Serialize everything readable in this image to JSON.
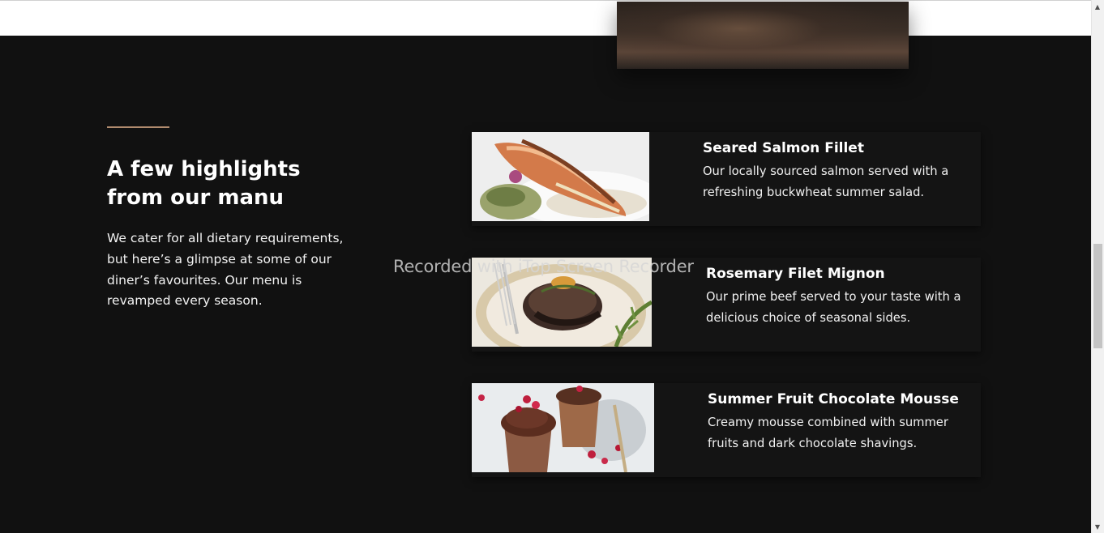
{
  "section": {
    "title": "A few highlights from our manu",
    "description": "We cater for all dietary requirements, but here’s a glimpse at some of our diner’s favourites. Our menu is revamped every season."
  },
  "menu": {
    "items": [
      {
        "title": "Seared Salmon Fillet",
        "description": "Our locally sourced salmon served with a refreshing buckwheat summer salad."
      },
      {
        "title": "Rosemary Filet Mignon",
        "description": "Our prime beef served to your taste with a delicious choice of seasonal sides."
      },
      {
        "title": "Summer Fruit Chocolate Mousse",
        "description": "Creamy mousse combined with summer fruits and dark chocolate shavings."
      }
    ]
  },
  "overlay": {
    "watermark": "Recorded with iTop Screen Recorder"
  },
  "scrollbar": {
    "up_icon": "▲",
    "down_icon": "▼"
  },
  "colors": {
    "background": "#111111",
    "card": "#141414",
    "accent": "#b08b6e",
    "text": "#ffffff"
  }
}
